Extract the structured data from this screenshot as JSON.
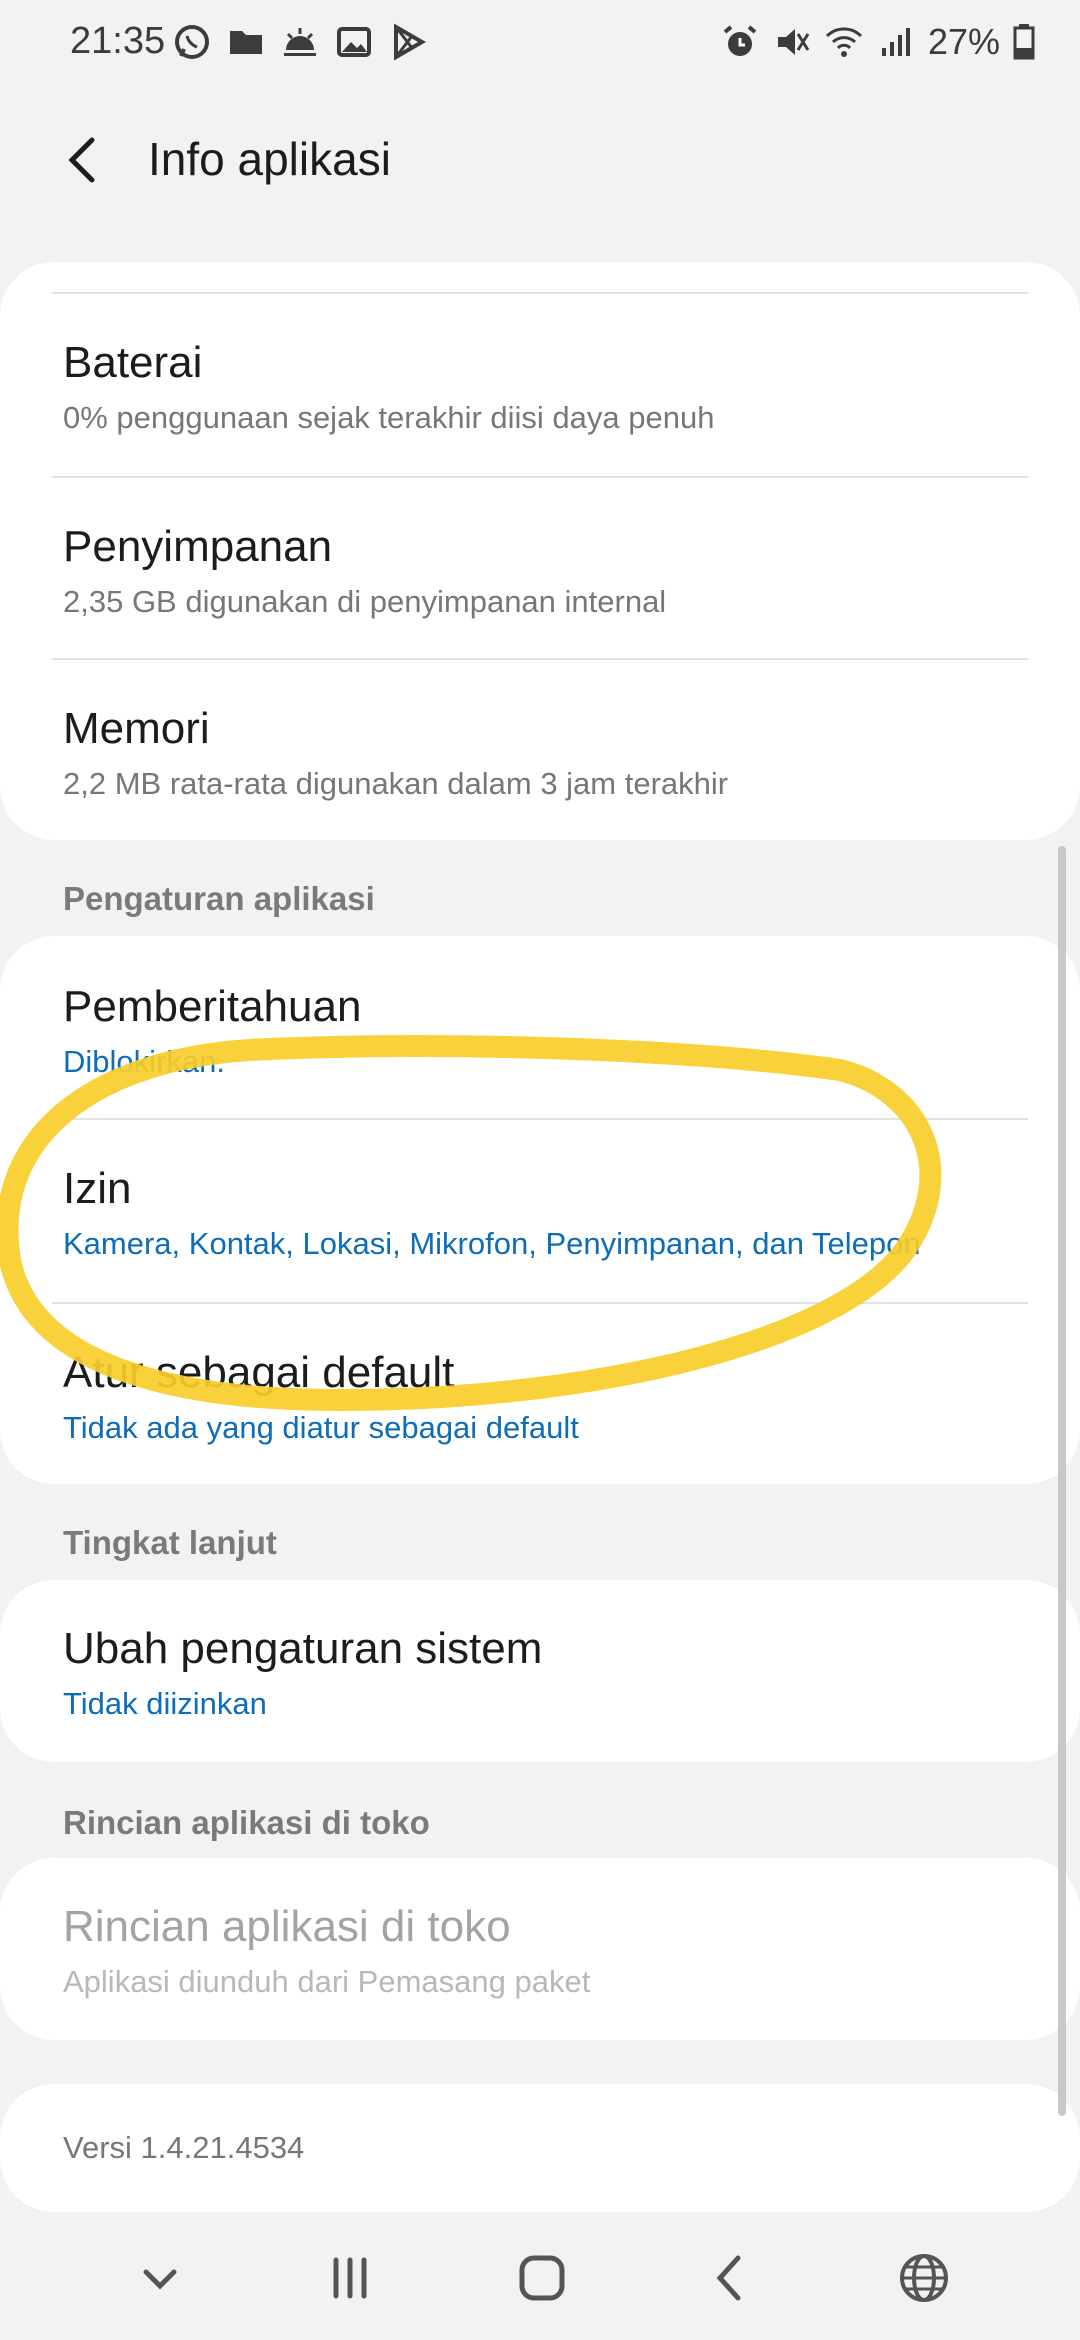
{
  "status_bar": {
    "time": "21:35",
    "left_icons": [
      "whatsapp-icon",
      "folder-icon",
      "weather-icon",
      "gallery-icon",
      "play-store-icon"
    ],
    "right_icons": [
      "alarm-icon",
      "mute-icon",
      "wifi-icon",
      "signal-icon"
    ],
    "battery_percent": "27%"
  },
  "header": {
    "title": "Info aplikasi"
  },
  "usage_card": {
    "items": [
      {
        "title": "Baterai",
        "subtitle": "0% penggunaan sejak terakhir diisi daya penuh"
      },
      {
        "title": "Penyimpanan",
        "subtitle": "2,35 GB digunakan di penyimpanan internal"
      },
      {
        "title": "Memori",
        "subtitle": "2,2 MB rata-rata digunakan dalam 3 jam terakhir"
      }
    ]
  },
  "app_settings": {
    "section_label": "Pengaturan aplikasi",
    "items": [
      {
        "title": "Pemberitahuan",
        "subtitle": "Diblokirkan."
      },
      {
        "title": "Izin",
        "subtitle": "Kamera, Kontak, Lokasi, Mikrofon, Penyimpanan, dan Telepon"
      },
      {
        "title": "Atur sebagai default",
        "subtitle": "Tidak ada yang diatur sebagai default"
      }
    ]
  },
  "advanced": {
    "section_label": "Tingkat lanjut",
    "items": [
      {
        "title": "Ubah pengaturan sistem",
        "subtitle": "Tidak diizinkan"
      }
    ]
  },
  "store": {
    "section_label": "Rincian aplikasi di toko",
    "items": [
      {
        "title": "Rincian aplikasi di toko",
        "subtitle": "Aplikasi diunduh dari Pemasang paket"
      }
    ]
  },
  "version": {
    "text": "Versi 1.4.21.4534"
  },
  "nav_bar": {
    "buttons": [
      "hide-keyboard-icon",
      "recents-icon",
      "home-icon",
      "back-icon",
      "language-icon"
    ]
  },
  "colors": {
    "background": "#f3f1f4",
    "card": "#ffffff",
    "accent_blue": "#0e6db7",
    "annotation_yellow": "#f7cd2a"
  }
}
